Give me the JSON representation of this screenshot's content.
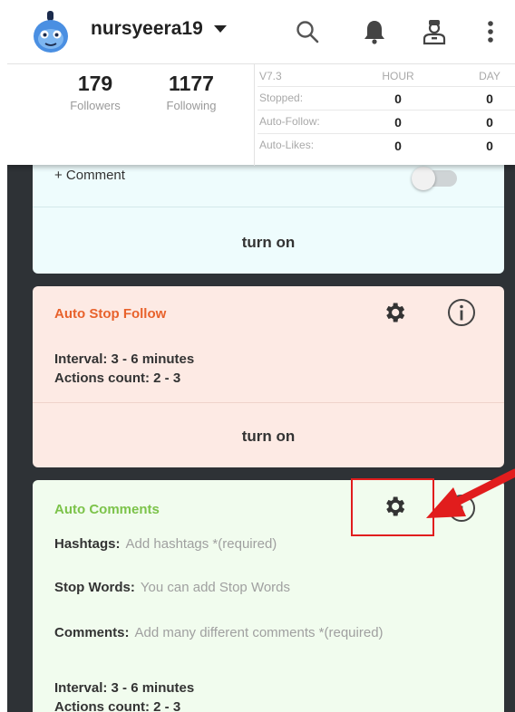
{
  "header": {
    "username": "nursyeera19",
    "icons": [
      "avatar-icon",
      "search-icon",
      "bell-icon",
      "user-icon",
      "more-vert-icon"
    ]
  },
  "stats": {
    "followers": {
      "value": "179",
      "label": "Followers"
    },
    "following": {
      "value": "1177",
      "label": "Following"
    },
    "table": {
      "version": "V7.3",
      "col_hour": "HOUR",
      "col_day": "DAY",
      "rows": [
        {
          "label": "Stopped:",
          "hour": "0",
          "day": "0"
        },
        {
          "label": "Auto-Follow:",
          "hour": "0",
          "day": "0"
        },
        {
          "label": "Auto-Likes:",
          "hour": "0",
          "day": "0"
        }
      ]
    }
  },
  "cards": {
    "comment_card": {
      "label": "+ Comment",
      "button": "turn on",
      "bg": "#eefcfd"
    },
    "auto_stop_follow": {
      "title": "Auto Stop Follow",
      "title_color": "#e8622c",
      "interval": "Interval: 3 - 6 minutes",
      "actions": "Actions count: 2 - 3",
      "button": "turn on",
      "bg": "#fdeae4"
    },
    "auto_comments": {
      "title": "Auto Comments",
      "title_color": "#7cc34a",
      "fields": [
        {
          "key": "Hashtags:",
          "placeholder": "Add hashtags *(required)"
        },
        {
          "key": "Stop Words:",
          "placeholder": "You can add Stop Words"
        },
        {
          "key": "Comments:",
          "placeholder": "Add many different comments *(required)"
        }
      ],
      "interval": "Interval: 3 - 6 minutes",
      "actions": "Actions count: 2 - 3",
      "bg": "#f1fcee"
    }
  },
  "colors": {
    "frame": "#2e3236",
    "highlight": "#e11d1d"
  }
}
